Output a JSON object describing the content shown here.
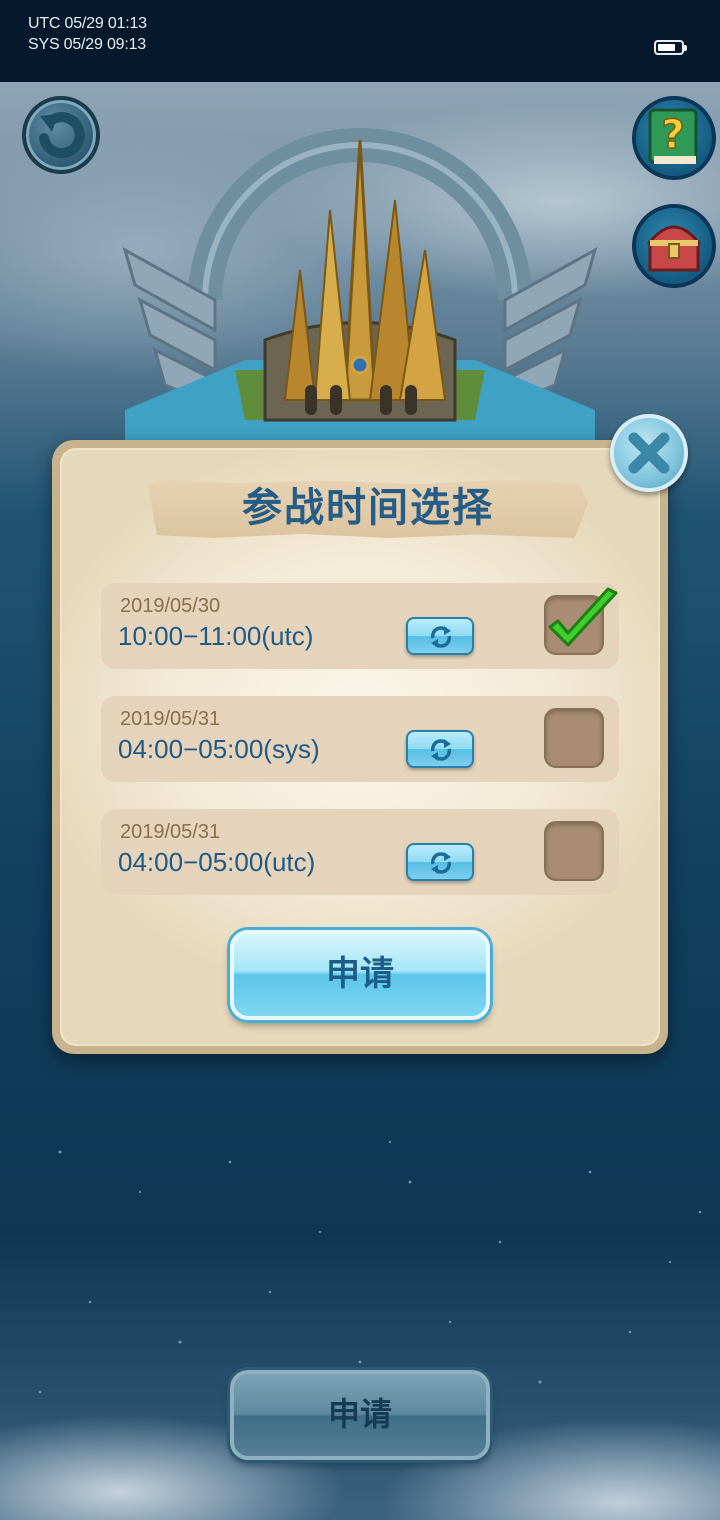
{
  "status_bar": {
    "utc_line": "UTC 05/29 01:13",
    "sys_line": "SYS 05/29 09:13",
    "battery_level": 0.75
  },
  "icons": {
    "back": "back-arrow-icon",
    "help": "help-book-icon",
    "chest": "treasure-chest-icon",
    "close": "close-icon",
    "refresh": "refresh-icon",
    "check": "checkmark-icon"
  },
  "dialog": {
    "title": "参战时间选择",
    "slots": [
      {
        "date": "2019/05/30",
        "time": "10:00−11:00(utc)",
        "selected": true
      },
      {
        "date": "2019/05/31",
        "time": "04:00−05:00(sys)",
        "selected": false
      },
      {
        "date": "2019/05/31",
        "time": "04:00−05:00(utc)",
        "selected": false
      }
    ],
    "apply_label": "申请"
  },
  "background": {
    "apply_label": "申请"
  },
  "colors": {
    "title_blue": "#255d86",
    "time_blue": "#1f5a86",
    "date_brown": "#8a6e4f",
    "check_green": "#3fcf2c",
    "button_cyan": "#7fd7f1"
  }
}
